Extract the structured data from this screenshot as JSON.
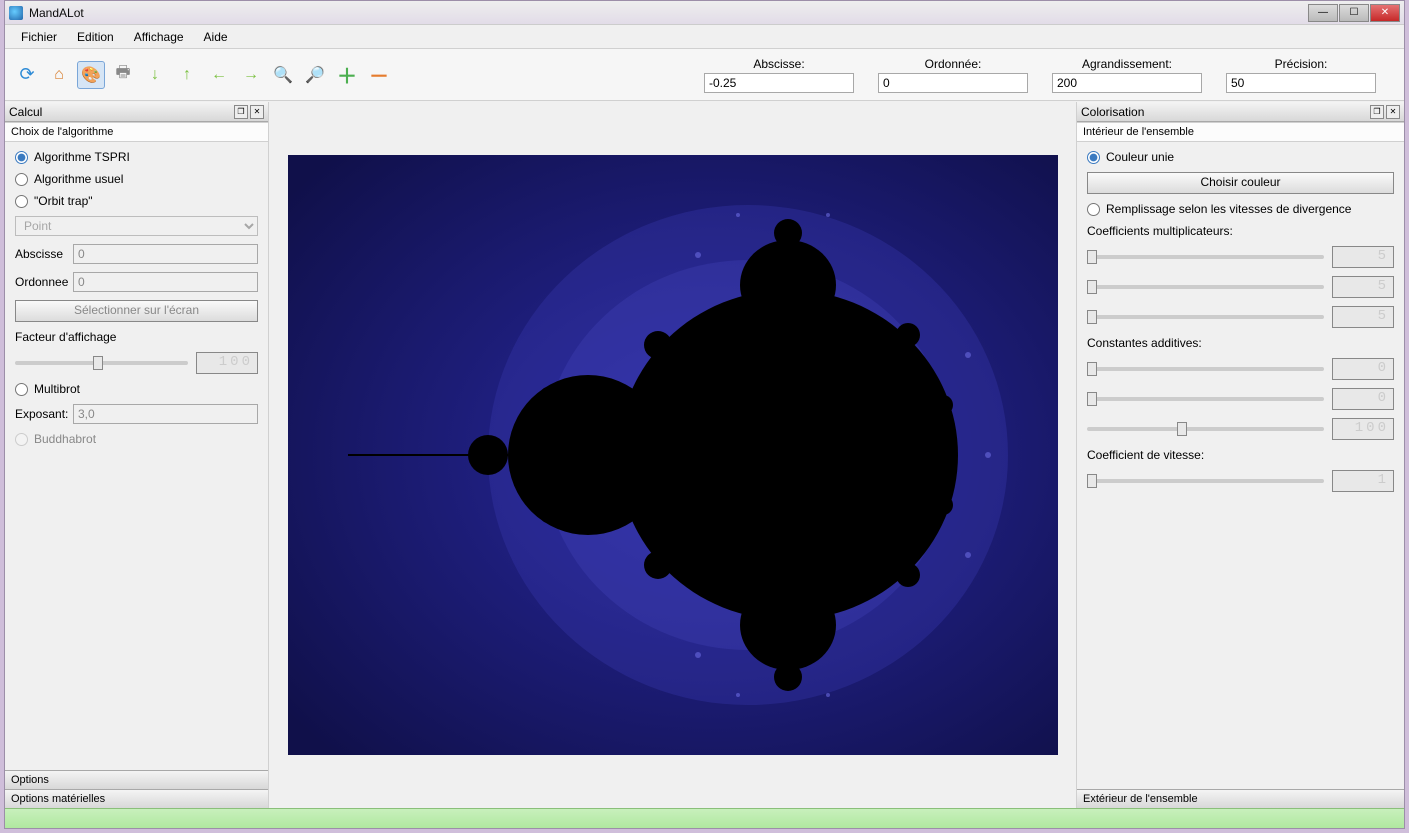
{
  "window": {
    "title": "MandALot"
  },
  "menu": {
    "items": [
      "Fichier",
      "Edition",
      "Affichage",
      "Aide"
    ]
  },
  "toolbarFields": {
    "abscisse": {
      "label": "Abscisse:",
      "value": "-0.25"
    },
    "ordonnee": {
      "label": "Ordonnée:",
      "value": "0"
    },
    "agrandissement": {
      "label": "Agrandissement:",
      "value": "200"
    },
    "precision": {
      "label": "Précision:",
      "value": "50"
    }
  },
  "calcul": {
    "title": "Calcul",
    "algoHeader": "Choix de l'algorithme",
    "algo": {
      "tspri": "Algorithme TSPRI",
      "usuel": "Algorithme usuel",
      "orbit": "\"Orbit trap\"",
      "pointOption": "Point",
      "abscisseLabel": "Abscisse",
      "ordonneeLabel": "Ordonnee",
      "abscisseVal": "0",
      "ordonneeVal": "0",
      "selectBtn": "Sélectionner sur l'écran"
    },
    "facteur": {
      "label": "Facteur d'affichage",
      "lcd": "100"
    },
    "multibrot": {
      "label": "Multibrot",
      "exposantLabel": "Exposant:",
      "exposantVal": "3,0"
    },
    "buddhabrot": "Buddhabrot",
    "tabs": {
      "options": "Options",
      "optionsMat": "Options matérielles"
    }
  },
  "color": {
    "title": "Colorisation",
    "interieur": "Intérieur de l'ensemble",
    "couleurUnie": "Couleur unie",
    "choisirBtn": "Choisir couleur",
    "remplissage": "Remplissage selon les vitesses de divergence",
    "coefMult": "Coefficients multiplicateurs:",
    "constAdd": "Constantes additives:",
    "coefVit": "Coefficient de vitesse:",
    "lcd5": "5",
    "lcd0": "0",
    "lcd100": "100",
    "lcd1": "1",
    "exterieur": "Extérieur de l'ensemble"
  }
}
